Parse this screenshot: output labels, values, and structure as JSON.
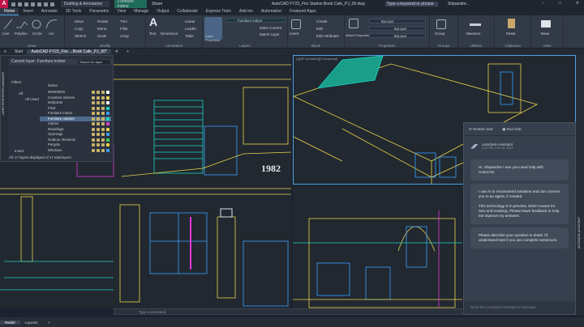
{
  "app": {
    "title": "AutoCAD FY23_Fire Station Book Cafe_PJ_00.dwg",
    "workspace": "Drafting & Annotation",
    "current_layer": "Furniture indoor",
    "share_label": "Share",
    "search_placeholder": "Type a keyword or phrase",
    "user": "Shipandre..."
  },
  "ribbon_tabs": [
    "Home",
    "Insert",
    "Annotate",
    "3D Tools",
    "Parametric",
    "View",
    "Manage",
    "Output",
    "Collaborate",
    "Express Tools",
    "Add-ins",
    "Automation",
    "Featured Apps"
  ],
  "ribbon": {
    "draw": {
      "title": "Draw",
      "tools": [
        "Line",
        "Polyline",
        "Circle",
        "Arc"
      ]
    },
    "modify": {
      "title": "Modify",
      "tools": [
        "Move",
        "Rotate",
        "Trim",
        "Copy",
        "Mirror",
        "Fillet",
        "Stretch",
        "Scale",
        "Array"
      ]
    },
    "annotation": {
      "title": "Annotation",
      "tools": [
        "Text",
        "Dimension",
        "Linear",
        "Leader",
        "Table"
      ]
    },
    "layers": {
      "title": "Layers",
      "tools": [
        "Layer Properties",
        "Make Current",
        "Match Layer"
      ],
      "layer_value": "Furniture indoor"
    },
    "block": {
      "title": "Block",
      "tools": [
        "Insert",
        "Create",
        "Edit",
        "Edit Attributes"
      ]
    },
    "properties": {
      "title": "Properties",
      "tools": [
        "Match Properties"
      ],
      "color": "ByLayer",
      "linetype": "ByLayer",
      "lineweight": "ByLayer"
    },
    "groups": {
      "title": "Groups",
      "tools": [
        "Group"
      ]
    },
    "utilities": {
      "title": "Utilities",
      "tools": [
        "Measure"
      ]
    },
    "clipboard": {
      "title": "Clipboard",
      "tools": [
        "Paste"
      ]
    },
    "view": {
      "title": "View",
      "tools": [
        "Base"
      ]
    }
  },
  "file_tabs": {
    "start": "Start",
    "active": "AutoCAD FY23_Fire ...Book Cafe_PJ_00*"
  },
  "layer_panel": {
    "title": "Current layer: Furniture indoor",
    "search_placeholder": "Search for layer",
    "filters_label": "Filters",
    "all_label": "All",
    "all_used": "All Used",
    "invert_label": "Invert",
    "name_header": "Name",
    "layers": [
      "BORDERS",
      "Counters shelves",
      "Defpoints",
      "Floor",
      "Furniture indoor",
      "Furniture outdoor",
      "Interior",
      "Mouldings",
      "Openings",
      "Outdoor elements",
      "Pergola",
      "Windows"
    ],
    "selected": "Furniture outdoor",
    "footer": "All: 17 layers displayed of 17 total layers",
    "side_label": "LAYER PROPERTIES MANAGER"
  },
  "viewports": {
    "top_right_label": "[-][SE Isometric][Conceptual]",
    "drawing_year": "1982"
  },
  "chat": {
    "restart": "Restart chat",
    "end": "End chat",
    "bot_name": "Autodesk Assistant",
    "time": "2:32 PM, Feb 16, 2024",
    "messages": [
      [
        "Hi, Shipandre! I see you need help with AutoCAD."
      ],
      [
        "I use AI to recommend solutions and can connect you to an agent, if needed.",
        "This technology is in preview, which means it's new and evolving. Please leave feedback to help me improve my answers."
      ],
      [
        "Please describe your question in detail. I'll understand best if you use complete sentences."
      ]
    ],
    "input_placeholder": "Send the Autodesk Assistant a message",
    "side_label": "AUTODESK ASSISTANT"
  },
  "command_placeholder": "Type a command",
  "status": {
    "model": "Model",
    "layout": "Layout1",
    "add": "+"
  },
  "colors": {
    "accent": "#4aa3df",
    "logo": "#c4154b",
    "canvas": "#212830",
    "cyan": "#19d3c5",
    "yellow": "#e8d24a",
    "magenta": "#e03ad8"
  }
}
